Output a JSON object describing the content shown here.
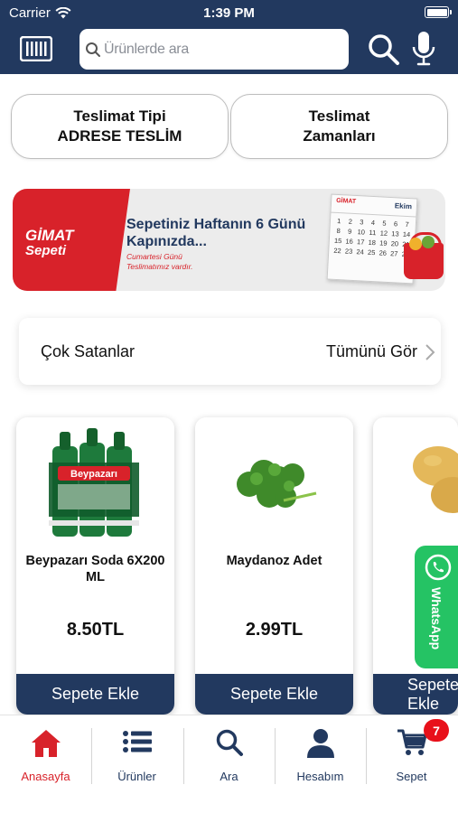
{
  "status_bar": {
    "carrier": "Carrier",
    "time": "1:39 PM"
  },
  "header": {
    "search_placeholder": "Ürünlerde ara"
  },
  "delivery": {
    "type_label": "Teslimat Tipi",
    "type_value": "ADRESE TESLİM",
    "times_line1": "Teslimat",
    "times_line2": "Zamanları"
  },
  "banner": {
    "logo_line1": "GİMAT",
    "logo_line2": "Sepeti",
    "headline": "Sepetiniz Haftanın 6 Günü Kapınızda...",
    "sub_line1": "Cumartesi Günü",
    "sub_line2": "Teslimatımız vardır.",
    "calendar_logo": "GİMAT",
    "calendar_month": "Ekim",
    "calendar_days": [
      "1",
      "2",
      "3",
      "4",
      "5",
      "6",
      "7",
      "8",
      "9",
      "10",
      "11",
      "12",
      "13",
      "14",
      "15",
      "16",
      "17",
      "18",
      "19",
      "20",
      "21",
      "22",
      "23",
      "24",
      "25",
      "26",
      "27",
      "28"
    ]
  },
  "section": {
    "title": "Çok Satanlar",
    "see_all": "Tümünü Gör"
  },
  "products": [
    {
      "name": "Beypazarı Soda 6X200 ML",
      "price": "8.50TL",
      "button": "Sepete Ekle"
    },
    {
      "name": "Maydanoz Adet",
      "price": "2.99TL",
      "button": "Sepete Ekle"
    },
    {
      "name": "",
      "price": "",
      "button": "Sepete Ekle"
    }
  ],
  "product_brand_label": "Beypazarı",
  "whatsapp": {
    "label": "WhatsApp"
  },
  "tabbar": {
    "items": [
      {
        "label": "Anasayfa",
        "icon": "home-icon"
      },
      {
        "label": "Ürünler",
        "icon": "list-icon"
      },
      {
        "label": "Ara",
        "icon": "search-icon"
      },
      {
        "label": "Hesabım",
        "icon": "user-icon"
      },
      {
        "label": "Sepet",
        "icon": "cart-icon",
        "badge": "7"
      }
    ]
  },
  "colors": {
    "navy": "#22395f",
    "red": "#d8222a",
    "whatsapp_green": "#25c364"
  }
}
